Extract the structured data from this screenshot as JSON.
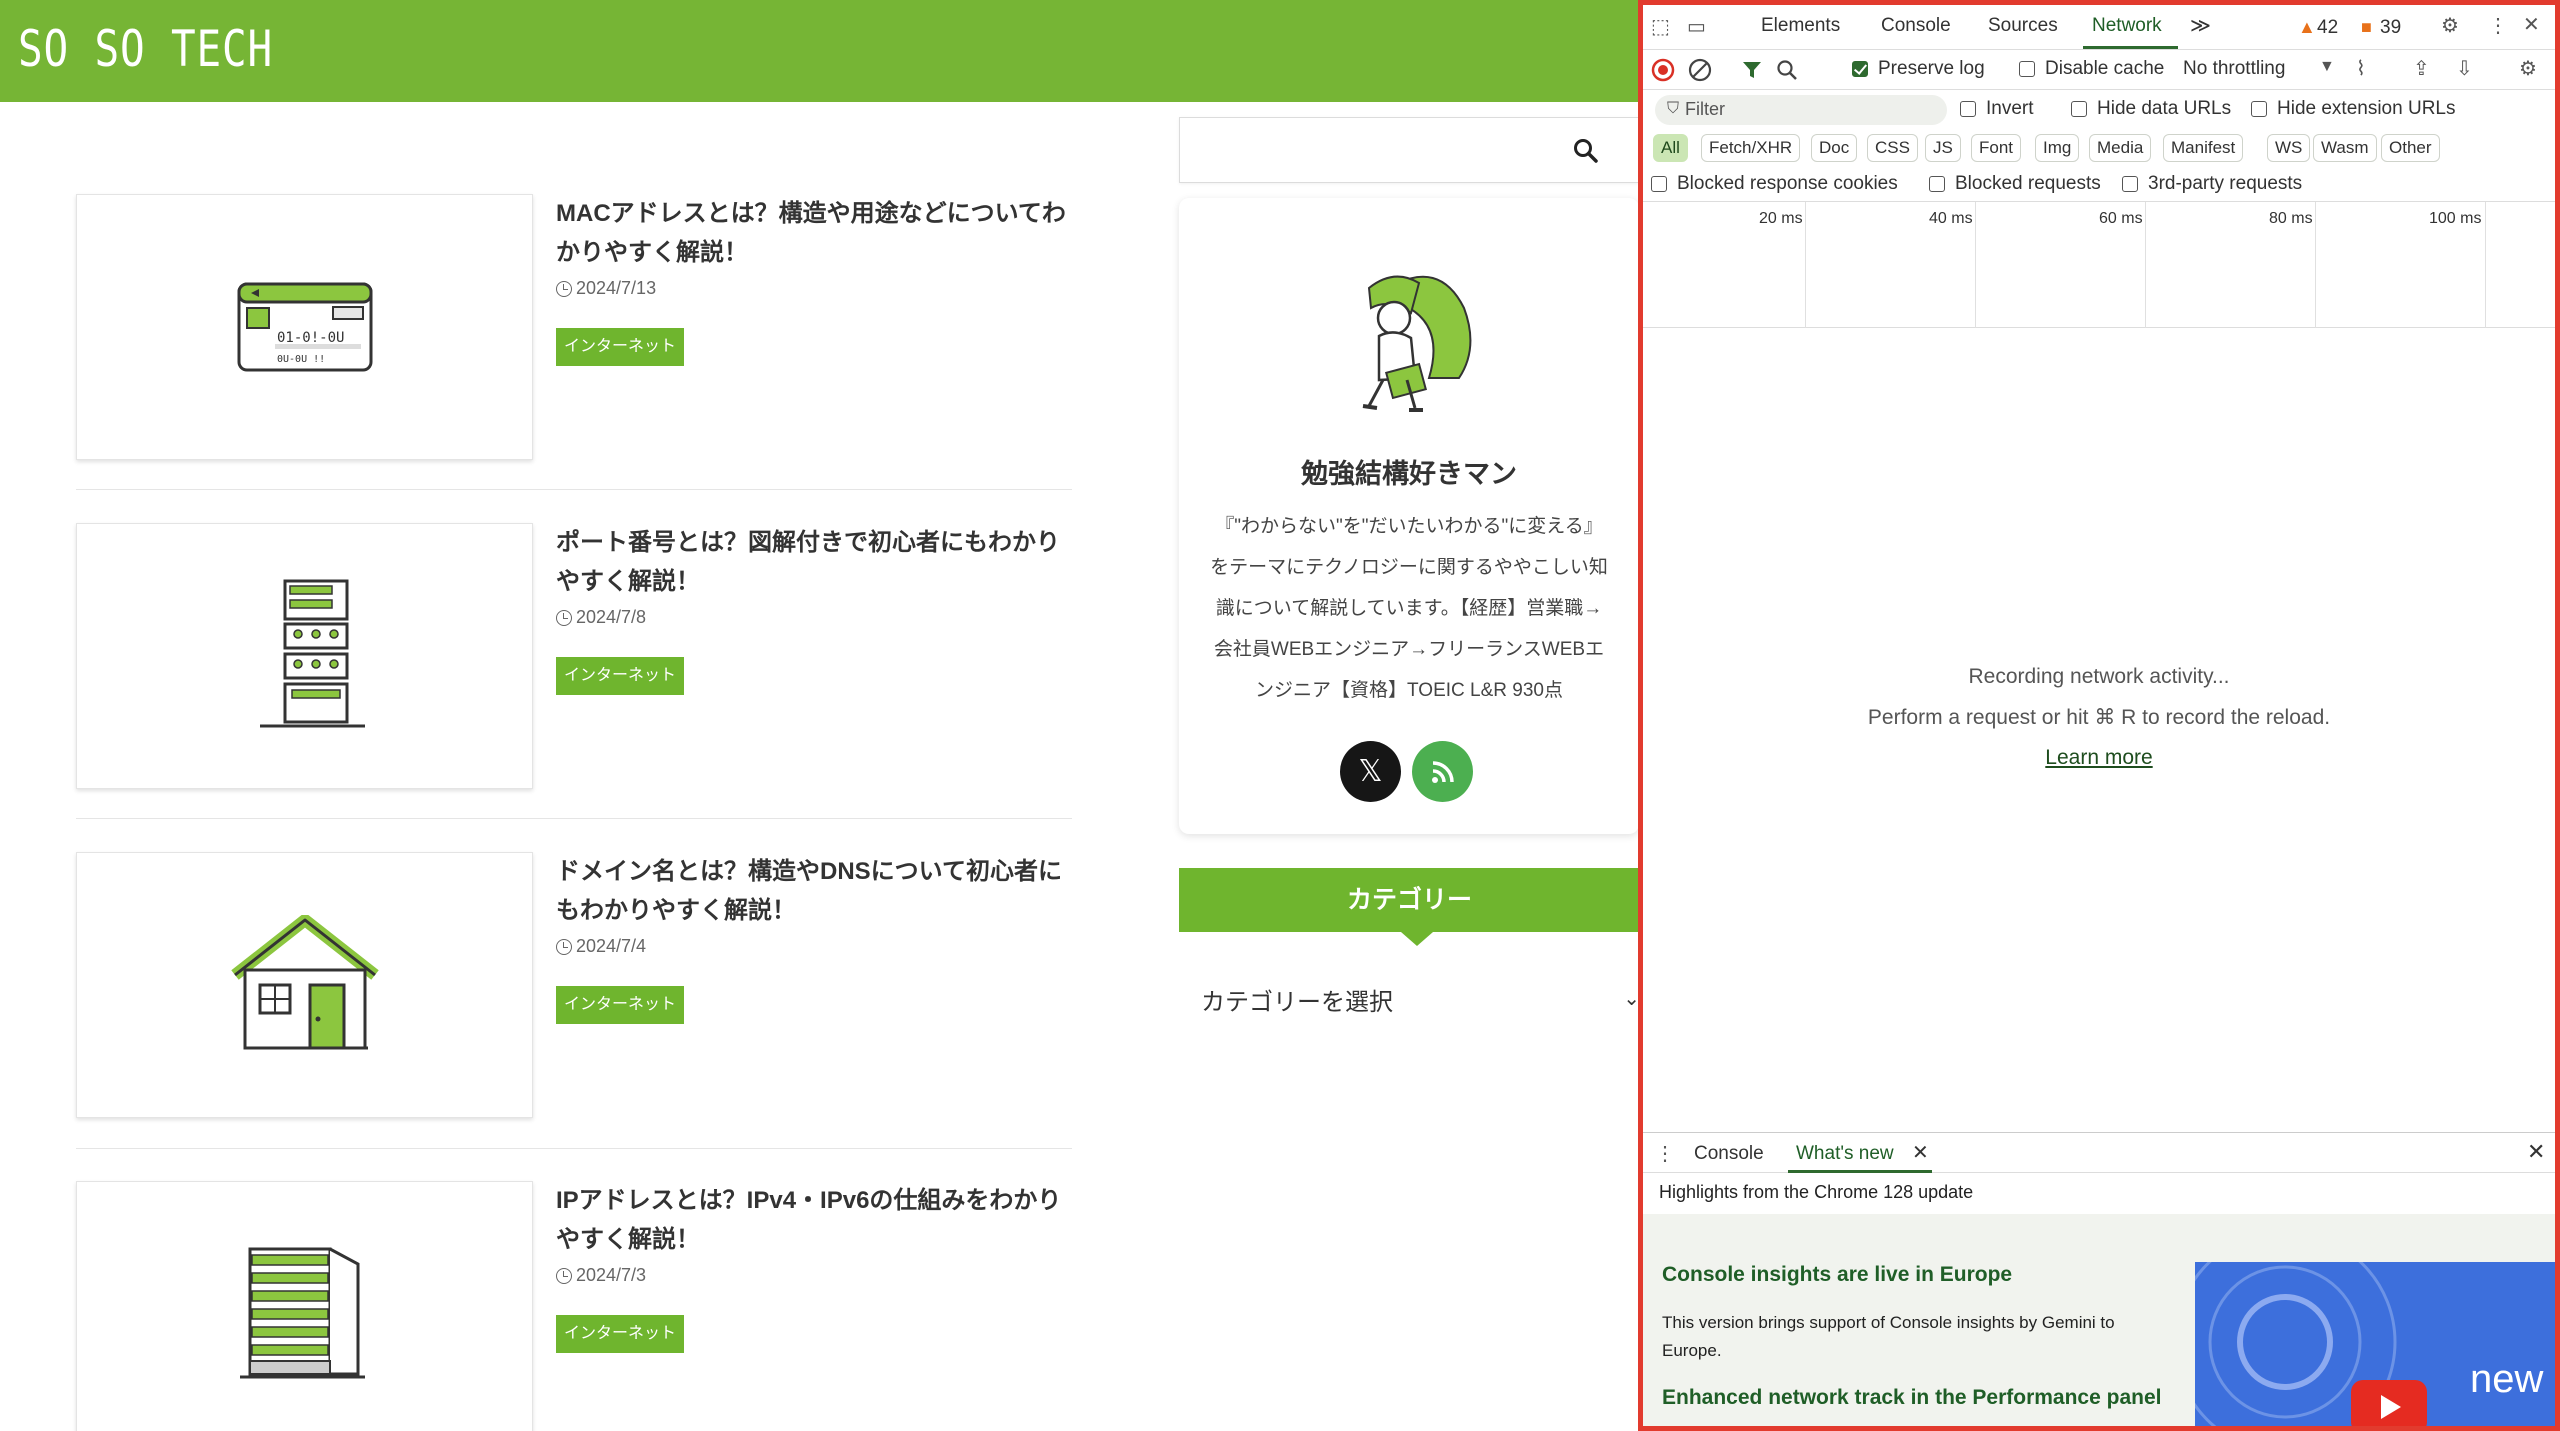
{
  "site": {
    "logo": "SO SO TECH",
    "posts": [
      {
        "title": "MACアドレスとは？構造や用途などについてわかりやすく解説！",
        "date": "2024/7/13",
        "tag": "インターネット",
        "thumb_icon": "network-card-icon"
      },
      {
        "title": "ポート番号とは？図解付きで初心者にもわかりやすく解説！",
        "date": "2024/7/8",
        "tag": "インターネット",
        "thumb_icon": "server-rack-icon"
      },
      {
        "title": "ドメイン名とは？構造やDNSについて初心者にもわかりやすく解説！",
        "date": "2024/7/4",
        "tag": "インターネット",
        "thumb_icon": "house-icon"
      },
      {
        "title": "IPアドレスとは？IPv4・IPv6の仕組みをわかりやすく解説！",
        "date": "2024/7/3",
        "tag": "インターネット",
        "thumb_icon": "apartment-building-icon"
      }
    ],
    "sidebar": {
      "search_placeholder": "",
      "profile_name": "勉強結構好きマン",
      "profile_bio": "『\"わからない\"を\"だいたいわかる\"に変える』をテーマにテクノロジーに関するややこしい知識について解説しています。【経歴】営業職→会社員WEBエンジニア→フリーランスWEBエンジニア【資格】TOEIC L&R 930点",
      "x_glyph": "𝕏",
      "category_heading": "カテゴリー",
      "category_select": "カテゴリーを選択",
      "chevron": "⌄"
    },
    "colors": {
      "brand_green": "#76b535",
      "tag_green": "#6fb52e"
    }
  },
  "devtools": {
    "tabs": [
      "Elements",
      "Console",
      "Sources",
      "Network"
    ],
    "active_tab": "Network",
    "more_tabs": "≫",
    "warnings": "42",
    "errors": "39",
    "toolbar": {
      "preserve_log": "Preserve log",
      "disable_cache": "Disable cache",
      "throttling": "No throttling"
    },
    "filter": {
      "placeholder": "Filter",
      "invert": "Invert",
      "hide_data_urls": "Hide data URLs",
      "hide_extension_urls": "Hide extension URLs"
    },
    "types": [
      "All",
      "Fetch/XHR",
      "Doc",
      "CSS",
      "JS",
      "Font",
      "Img",
      "Media",
      "Manifest",
      "WS",
      "Wasm",
      "Other"
    ],
    "extra_filters": {
      "blocked_cookies": "Blocked response cookies",
      "blocked_requests": "Blocked requests",
      "third_party": "3rd-party requests"
    },
    "timeline_ticks": [
      "20 ms",
      "40 ms",
      "60 ms",
      "80 ms",
      "100 ms"
    ],
    "empty_state": {
      "line1": "Recording network activity...",
      "line2": "Perform a request or hit ⌘ R to record the reload.",
      "link": "Learn more"
    },
    "drawer": {
      "tab_console": "Console",
      "tab_whats_new": "What's new",
      "highlights": "Highlights from the Chrome 128 update",
      "news1_title": "Console insights are live in Europe",
      "news1_body": "This version brings support of Console insights by Gemini to Europe.",
      "news2_title": "Enhanced network track in the Performance panel",
      "image_text": "new"
    },
    "colors": {
      "accent": "#2e6a2f",
      "frame": "#e23b2e"
    }
  }
}
